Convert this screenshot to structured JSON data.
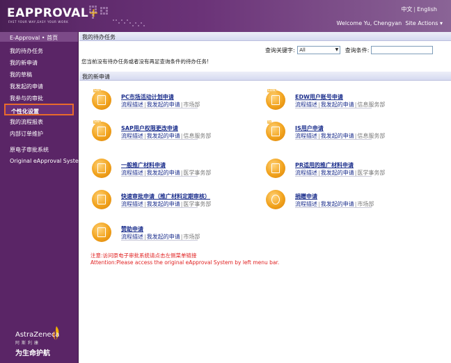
{
  "header": {
    "logo": "EAPPROVAL",
    "logo_plus": "+",
    "tagline": "FAST YOUR WAY,EASY YOUR WORK",
    "lang_cn": "中文",
    "lang_sep": "|",
    "lang_en": "English",
    "welcome": "Welcome Yu, Chengyan",
    "site_actions": "Site Actions"
  },
  "sidebar": {
    "home": "E-Approval • 首页",
    "items": [
      {
        "label": "我的待办任务"
      },
      {
        "label": "我的新申请"
      },
      {
        "label": "我的草稿"
      },
      {
        "label": "我发起的申请"
      },
      {
        "label": "我参与的审批"
      },
      {
        "label": "个性化设置"
      },
      {
        "label": "我的流程报表"
      },
      {
        "label": "内部订单维护"
      },
      {
        "label": "原电子审批系统"
      },
      {
        "label": "Original eApproval System"
      }
    ],
    "brand": "AstraZeneca",
    "brand_cn": "阿斯利康",
    "slogan": "为生命护航"
  },
  "main": {
    "todo_title": "我的待办任务",
    "search_keyword_label": "查询关键字:",
    "search_select_value": "All",
    "search_condition_label": "查询条件:",
    "search_input_value": "",
    "empty_message": "您当前没有待办任务或者没有再足查询条件的待办任务!",
    "new_title": "我的新申请",
    "link_desc": "流程描述",
    "link_mine": "我发起的申请",
    "requests": [
      {
        "title": "PC市场活动计划申请",
        "dept": "市场部",
        "tag": "SAP"
      },
      {
        "title": "EDW用户账号申请",
        "dept": "信息服务部",
        "tag": "EDW"
      },
      {
        "title": "SAP用户权限更改申请",
        "dept": "信息服务部",
        "tag": "SAP"
      },
      {
        "title": "IS用户申请",
        "dept": "信息服务部",
        "tag": "IS"
      },
      {
        "title": "一般推广材料申请",
        "dept": "医学事务部",
        "tag": ""
      },
      {
        "title": "PR适用的推广材料申请",
        "dept": "医学事务部",
        "tag": ""
      },
      {
        "title": "快速审批申请（推广材料定期审核）",
        "dept": "医学事务部",
        "tag": ""
      },
      {
        "title": "捐赠申请",
        "dept": "市场部",
        "tag": ""
      },
      {
        "title": "赞助申请",
        "dept": "市场部",
        "tag": ""
      }
    ],
    "note_cn": "注意:访问原电子审批系统请点击左侧菜单链接",
    "note_en": "Attention:Please access the original eApproval System by left menu bar."
  },
  "colors": {
    "header_purple": "#5e2a6b",
    "sidebar_purple": "#5a2566",
    "active_border": "#e96b2b",
    "link_blue": "#1b2e8c",
    "icon_orange": "#f1a21c",
    "note_red": "#e02020"
  }
}
